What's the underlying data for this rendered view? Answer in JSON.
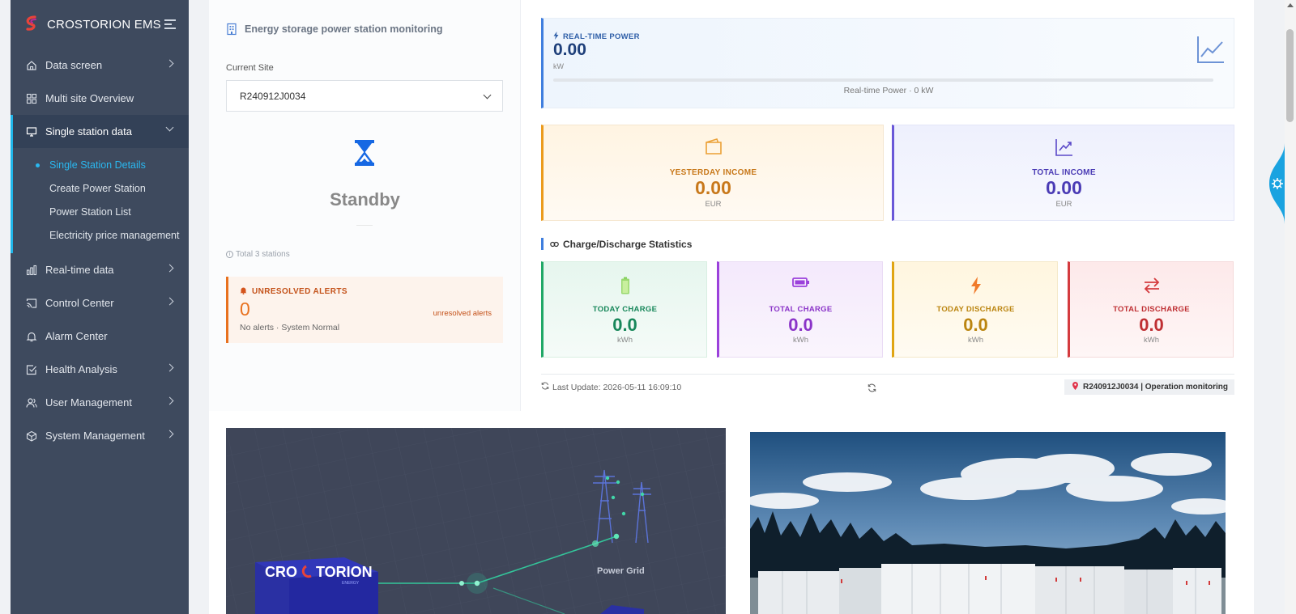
{
  "app": {
    "brand_name": "CROSTORION EMS"
  },
  "sidebar": {
    "items": [
      {
        "label": "Data screen",
        "icon": "home-icon",
        "has_arrow": true
      },
      {
        "label": "Multi site Overview",
        "icon": "grid-icon",
        "has_arrow": false
      },
      {
        "label": "Single station data",
        "icon": "monitor-icon",
        "has_arrow": true,
        "expanded": true
      },
      {
        "label": "Real-time data",
        "icon": "bar-chart-icon",
        "has_arrow": true
      },
      {
        "label": "Control Center",
        "icon": "cast-icon",
        "has_arrow": true
      },
      {
        "label": "Alarm Center",
        "icon": "bell-icon",
        "has_arrow": false
      },
      {
        "label": "Health Analysis",
        "icon": "check-square-icon",
        "has_arrow": true
      },
      {
        "label": "User Management",
        "icon": "users-icon",
        "has_arrow": true
      },
      {
        "label": "System Management",
        "icon": "cube-icon",
        "has_arrow": true
      }
    ],
    "submenu": [
      {
        "label": "Single Station Details",
        "current": true
      },
      {
        "label": "Create Power Station"
      },
      {
        "label": "Power Station List"
      },
      {
        "label": "Electricity price management"
      }
    ]
  },
  "station": {
    "heading": "Energy storage power station monitoring",
    "current_site_label": "Current Site",
    "current_site_value": "R240912J0034",
    "status": "Standby",
    "total_stations": "Total 3 stations"
  },
  "alerts": {
    "title": "UNRESOLVED ALERTS",
    "count": "0",
    "side_label": "unresolved alerts",
    "note": "No alerts · System Normal"
  },
  "realtime": {
    "label": "REAL-TIME POWER",
    "value": "0.00",
    "unit": "kW",
    "caption": "Real-time Power · 0 kW",
    "progress": 0
  },
  "income": {
    "yesterday": {
      "label": "YESTERDAY INCOME",
      "value": "0.00",
      "unit": "EUR"
    },
    "total": {
      "label": "TOTAL INCOME",
      "value": "0.00",
      "unit": "EUR"
    }
  },
  "charge_stats": {
    "heading": "Charge/Discharge Statistics",
    "today_charge": {
      "label": "TODAY CHARGE",
      "value": "0.0",
      "unit": "kWh"
    },
    "total_charge": {
      "label": "TOTAL CHARGE",
      "value": "0.0",
      "unit": "kWh"
    },
    "today_discharge": {
      "label": "TODAY DISCHARGE",
      "value": "0.0",
      "unit": "kWh"
    },
    "total_discharge": {
      "label": "TOTAL DISCHARGE",
      "value": "0.0",
      "unit": "kWh"
    }
  },
  "footer": {
    "last_update": "Last Update: 2026-05-11 16:09:10",
    "site_chip": "R240912J0034 | Operation monitoring"
  },
  "diagram": {
    "logo_text_1": "CRO",
    "logo_text_2": "TORION",
    "logo_sub": "ENERGY",
    "grid_label": "Power Grid"
  },
  "colors": {
    "sidebar_bg": "#3e4a5e",
    "accent_blue": "#3f7ede",
    "active_cyan": "#2ab8f0",
    "alert_orange": "#e8711f"
  }
}
